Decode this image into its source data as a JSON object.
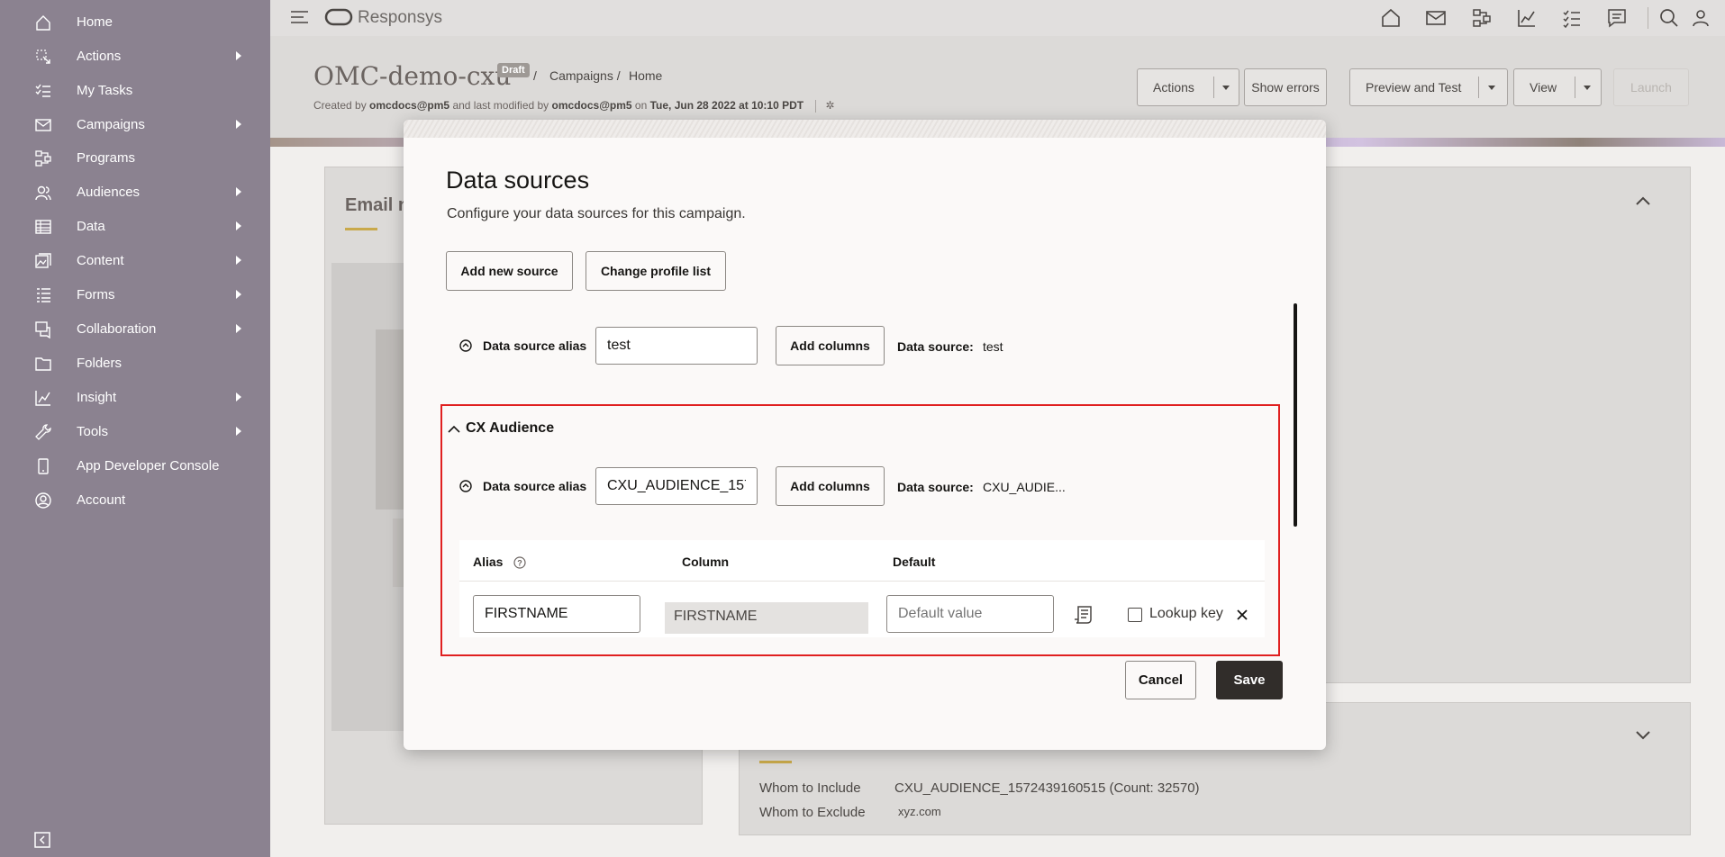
{
  "sidebar": {
    "items": [
      {
        "label": "Home",
        "icon": "home-icon",
        "has_submenu": false
      },
      {
        "label": "Actions",
        "icon": "actions-icon",
        "has_submenu": true
      },
      {
        "label": "My Tasks",
        "icon": "tasks-icon",
        "has_submenu": false
      },
      {
        "label": "Campaigns",
        "icon": "mail-icon",
        "has_submenu": true
      },
      {
        "label": "Programs",
        "icon": "programs-icon",
        "has_submenu": false
      },
      {
        "label": "Audiences",
        "icon": "audiences-icon",
        "has_submenu": true
      },
      {
        "label": "Data",
        "icon": "data-icon",
        "has_submenu": true
      },
      {
        "label": "Content",
        "icon": "content-icon",
        "has_submenu": true
      },
      {
        "label": "Forms",
        "icon": "forms-icon",
        "has_submenu": true
      },
      {
        "label": "Collaboration",
        "icon": "collaboration-icon",
        "has_submenu": true
      },
      {
        "label": "Folders",
        "icon": "folder-icon",
        "has_submenu": false
      },
      {
        "label": "Insight",
        "icon": "insight-icon",
        "has_submenu": true
      },
      {
        "label": "Tools",
        "icon": "wrench-icon",
        "has_submenu": true
      },
      {
        "label": "App Developer Console",
        "icon": "device-icon",
        "has_submenu": false
      },
      {
        "label": "Account",
        "icon": "account-icon",
        "has_submenu": false
      }
    ]
  },
  "topbar": {
    "brand": "Responsys"
  },
  "page": {
    "title": "OMC-demo-cxu",
    "badge": "Draft",
    "breadcrumb": [
      "Campaigns",
      "Home"
    ],
    "meta": {
      "created_prefix": "Created by ",
      "created_by": "omcdocs@pm5",
      "modified_prefix": " and last modified by ",
      "modified_by": "omcdocs@pm5",
      "on": " on ",
      "date": "Tue, Jun 28 2022 at 10:10 PDT"
    },
    "buttons": {
      "actions": "Actions",
      "show_errors": "Show errors",
      "preview_test": "Preview and Test",
      "view": "View",
      "launch": "Launch"
    }
  },
  "background": {
    "email_label": "Email n",
    "audience": {
      "include_label": "Whom to Include",
      "include_value": "CXU_AUDIENCE_1572439160515 (Count: 32570)",
      "exclude_label": "Whom to Exclude",
      "exclude_value": "xyz.com"
    }
  },
  "modal": {
    "title": "Data sources",
    "subtitle": "Configure your data sources for this campaign.",
    "add_new_source": "Add new source",
    "change_profile_list": "Change profile list",
    "sources": [
      {
        "alias_label": "Data source alias",
        "alias_value": "test",
        "add_columns": "Add columns",
        "source_label": "Data source:",
        "source_value": "test"
      },
      {
        "section_title": "CX Audience",
        "alias_label": "Data source alias",
        "alias_value": "CXU_AUDIENCE_1572",
        "add_columns": "Add columns",
        "source_label": "Data source:",
        "source_value": "CXU_AUDIE..."
      }
    ],
    "table": {
      "headers": {
        "alias": "Alias",
        "column": "Column",
        "default": "Default"
      },
      "row": {
        "alias": "FIRSTNAME",
        "column": "FIRSTNAME",
        "default_placeholder": "Default value",
        "lookup_label": "Lookup key",
        "lookup_checked": false
      }
    },
    "cancel": "Cancel",
    "save": "Save"
  }
}
